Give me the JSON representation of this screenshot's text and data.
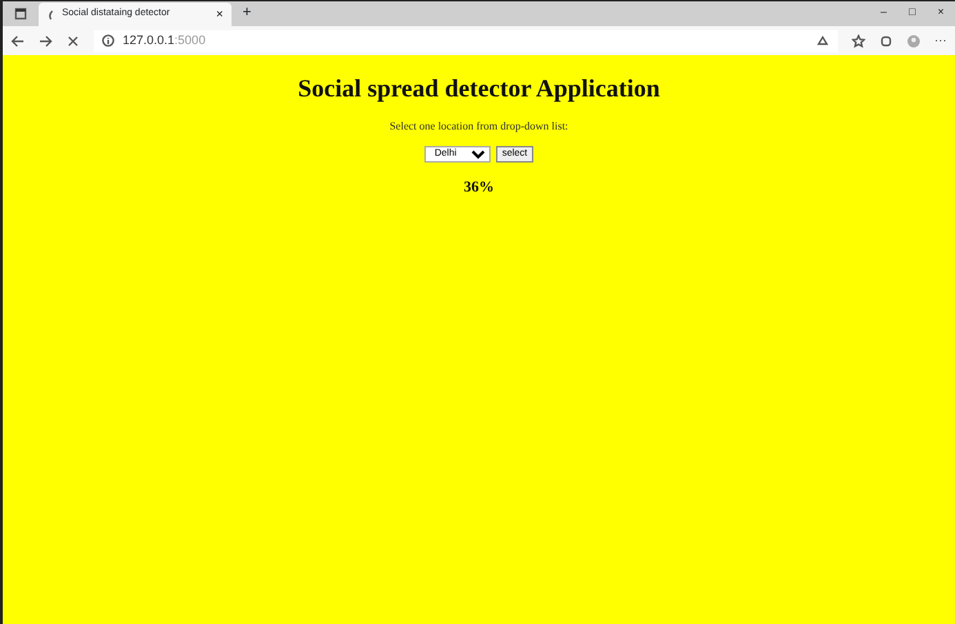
{
  "browser": {
    "tab_title": "Social distataing detector",
    "tab_close": "×",
    "new_tab": "+",
    "url_host": "127.0.0.1",
    "url_port": ":5000",
    "window_controls": [
      "–",
      "□",
      "×"
    ],
    "more": "···"
  },
  "page": {
    "heading": "Social spread detector Application",
    "prompt": "Select one location from drop-down list:",
    "location": "Delhi",
    "button": "select",
    "result": "36%"
  }
}
